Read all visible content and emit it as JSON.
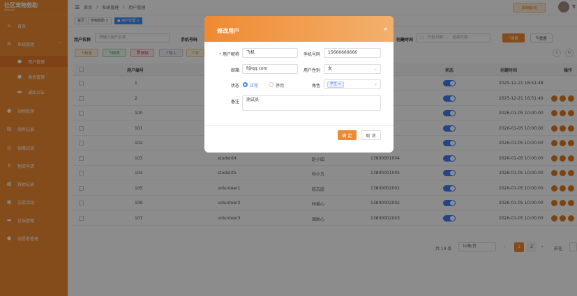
{
  "app": {
    "title": "社区宠物救助",
    "subtitle": "Admin"
  },
  "sidebar": {
    "items": [
      {
        "label": "首页",
        "icon": "home-icon"
      },
      {
        "label": "系统管理",
        "icon": "gear-icon"
      },
      {
        "label": "用户管理",
        "icon": "user-icon"
      },
      {
        "label": "角色管理",
        "icon": "users-icon"
      },
      {
        "label": "通知公告",
        "icon": "message-icon"
      },
      {
        "label": "动物管理",
        "icon": "paw-icon"
      },
      {
        "label": "领养记录",
        "icon": "document-icon"
      },
      {
        "label": "捐赠记录",
        "icon": "gift-icon"
      },
      {
        "label": "物资申请",
        "icon": "cart-icon"
      },
      {
        "label": "救助记录",
        "icon": "clipboard-icon"
      },
      {
        "label": "志愿活动",
        "icon": "calendar-icon"
      },
      {
        "label": "论坛管理",
        "icon": "chat-icon"
      },
      {
        "label": "志愿者管理",
        "icon": "team-icon"
      }
    ]
  },
  "header": {
    "breadcrumb": [
      "首页",
      "系统管理",
      "用户管理"
    ],
    "top_button": "系统前台",
    "user_name": "管"
  },
  "tabs": [
    {
      "label": "首页"
    },
    {
      "label": "宠物救助"
    },
    {
      "label": "用户管理"
    }
  ],
  "search": {
    "username_label": "用户名称",
    "username_placeholder": "请输入用户名称",
    "phone_label": "手机号码",
    "time_label": "创建时间",
    "start_placeholder": "开始日期",
    "end_placeholder": "结束日期",
    "search_button": "搜索",
    "reset_button": "重置"
  },
  "toolbar": {
    "add": "新增",
    "edit": "修改",
    "delete": "删除",
    "import": "导入",
    "export": "导"
  },
  "table": {
    "headers": [
      "用户编号",
      "状态",
      "创建时间",
      "操作"
    ],
    "rows": [
      {
        "id": "1",
        "name": "",
        "nick": "",
        "phone": "",
        "time": "2025-12-21 16:51:48"
      },
      {
        "id": "2",
        "name": "",
        "nick": "",
        "phone": "",
        "time": "2025-12-21 16:51:48"
      },
      {
        "id": "100",
        "name": "",
        "nick": "",
        "phone": "",
        "time": "2026-01-05 10:00:00"
      },
      {
        "id": "101",
        "name": "",
        "nick": "",
        "phone": "",
        "time": "2026-01-05 10:00:00"
      },
      {
        "id": "102",
        "name": "",
        "nick": "",
        "phone": "",
        "time": "2026-01-05 10:00:00"
      },
      {
        "id": "103",
        "name": "student4",
        "nick": "赵小四",
        "phone": "13800001004",
        "time": "2026-01-05 10:00:00"
      },
      {
        "id": "104",
        "name": "student5",
        "nick": "孙小五",
        "phone": "13800001005",
        "time": "2026-01-05 10:00:00"
      },
      {
        "id": "105",
        "name": "volunteer1",
        "nick": "陈志愿",
        "phone": "13800002001",
        "time": "2026-01-05 10:00:00"
      },
      {
        "id": "106",
        "name": "volunteer2",
        "nick": "林爱心",
        "phone": "13800002002",
        "time": "2026-01-05 10:00:00"
      },
      {
        "id": "107",
        "name": "volunteer3",
        "nick": "周助心",
        "phone": "13800002003",
        "time": "2026-01-05 10:00:00"
      }
    ]
  },
  "pager": {
    "total": "共 14 条",
    "size": "10条/页",
    "pages": [
      "1",
      "2"
    ],
    "goto": "前往"
  },
  "modal": {
    "title": "修改用户",
    "nickname_label": "用户昵称",
    "nickname_value": "飞机",
    "phone_label": "手机号码",
    "phone_value": "15666666666",
    "email_label": "邮箱",
    "email_value": "f@qq.com",
    "gender_label": "用户性别",
    "gender_value": "女",
    "status_label": "状态",
    "status_normal": "正常",
    "status_disabled": "停用",
    "role_label": "角色",
    "role_tag": "学生",
    "remark_label": "备注",
    "remark_value": "测试员",
    "confirm": "确 定",
    "cancel": "取 消"
  }
}
